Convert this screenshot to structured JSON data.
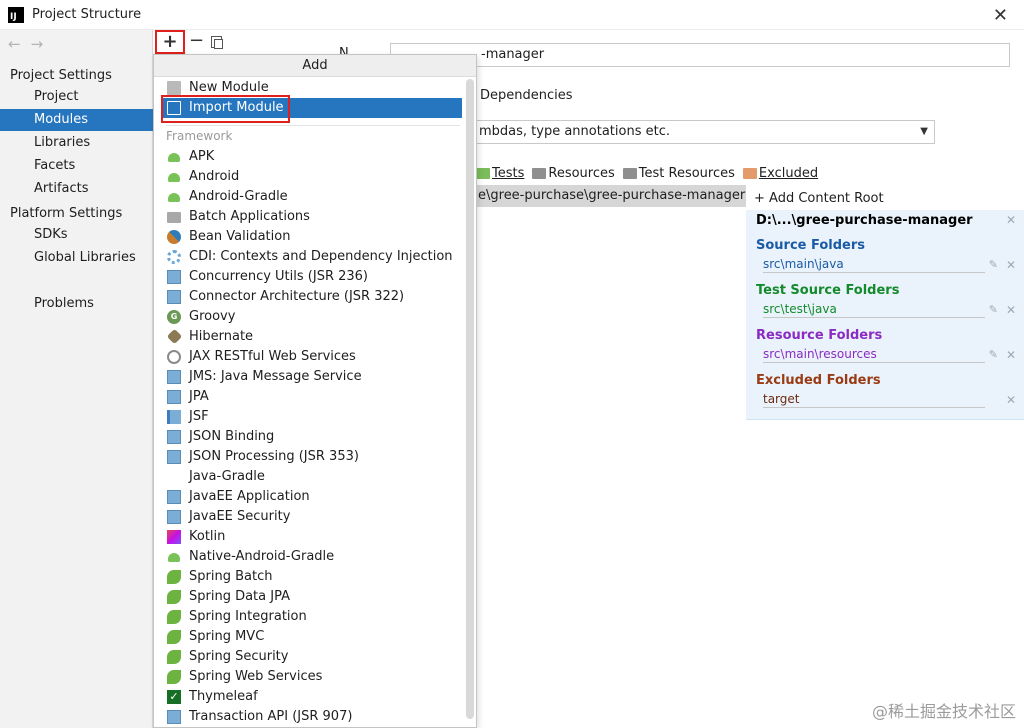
{
  "window": {
    "title": "Project Structure",
    "close": "✕"
  },
  "nav": {
    "back": "←",
    "forward": "→"
  },
  "sidebar": {
    "project_settings": "Project Settings",
    "project_items": [
      "Project",
      "Modules",
      "Libraries",
      "Facets",
      "Artifacts"
    ],
    "platform_settings": "Platform Settings",
    "platform_items": [
      "SDKs",
      "Global Libraries"
    ],
    "problems": "Problems",
    "selected": "Modules"
  },
  "toolbar": {
    "add": "+",
    "remove": "−"
  },
  "module": {
    "name_label": "N",
    "name_value": "-manager",
    "dependencies_tab": "Dependencies",
    "language_level": "mbdas, type annotations etc.",
    "mark_as": [
      "Tests",
      "Resources",
      "Test Resources",
      "Excluded"
    ],
    "content_path": "e\\gree-purchase\\gree-purchase-manager"
  },
  "content_root": {
    "add_label": "+ Add Content Root",
    "path": "D:\\...\\gree-purchase-manager",
    "source_folders": {
      "title": "Source Folders",
      "path": "src\\main\\java",
      "color": "#1a5aa6"
    },
    "test_source_folders": {
      "title": "Test Source Folders",
      "path": "src\\test\\java",
      "color": "#138a2b"
    },
    "resource_folders": {
      "title": "Resource Folders",
      "path": "src\\main\\resources",
      "color": "#8a2bc2"
    },
    "excluded_folders": {
      "title": "Excluded Folders",
      "path": "target",
      "color": "#9a3b14"
    }
  },
  "popup": {
    "title": "Add",
    "top_items": [
      {
        "label": "New Module",
        "icon": "module-icon"
      },
      {
        "label": "Import Module",
        "icon": "import-module-icon",
        "selected": true
      }
    ],
    "section_label": "Framework",
    "framework_items": [
      {
        "label": "APK",
        "icon": "android-icon"
      },
      {
        "label": "Android",
        "icon": "android-icon"
      },
      {
        "label": "Android-Gradle",
        "icon": "android-icon"
      },
      {
        "label": "Batch Applications",
        "icon": "folder-icon"
      },
      {
        "label": "Bean Validation",
        "icon": "bean-icon"
      },
      {
        "label": "CDI: Contexts and Dependency Injection",
        "icon": "cdi-icon"
      },
      {
        "label": "Concurrency Utils (JSR 236)",
        "icon": "jee-icon"
      },
      {
        "label": "Connector Architecture (JSR 322)",
        "icon": "jee-icon"
      },
      {
        "label": "Groovy",
        "icon": "groovy-icon"
      },
      {
        "label": "Hibernate",
        "icon": "hibernate-icon"
      },
      {
        "label": "JAX RESTful Web Services",
        "icon": "globe-icon"
      },
      {
        "label": "JMS: Java Message Service",
        "icon": "jee-icon"
      },
      {
        "label": "JPA",
        "icon": "jpa-icon"
      },
      {
        "label": "JSF",
        "icon": "jsf-icon"
      },
      {
        "label": "JSON Binding",
        "icon": "jee-icon"
      },
      {
        "label": "JSON Processing (JSR 353)",
        "icon": "jee-icon"
      },
      {
        "label": "Java-Gradle",
        "icon": "none"
      },
      {
        "label": "JavaEE Application",
        "icon": "jee-icon"
      },
      {
        "label": "JavaEE Security",
        "icon": "jee-icon"
      },
      {
        "label": "Kotlin",
        "icon": "kotlin-icon"
      },
      {
        "label": "Native-Android-Gradle",
        "icon": "android-icon"
      },
      {
        "label": "Spring Batch",
        "icon": "spring-icon"
      },
      {
        "label": "Spring Data JPA",
        "icon": "spring-icon"
      },
      {
        "label": "Spring Integration",
        "icon": "spring-icon"
      },
      {
        "label": "Spring MVC",
        "icon": "spring-icon"
      },
      {
        "label": "Spring Security",
        "icon": "spring-icon"
      },
      {
        "label": "Spring Web Services",
        "icon": "spring-icon"
      },
      {
        "label": "Thymeleaf",
        "icon": "thymeleaf-icon"
      },
      {
        "label": "Transaction API (JSR 907)",
        "icon": "jee-icon"
      }
    ]
  },
  "colors": {
    "accent": "#2675bf",
    "highlight_box": "#e0201c"
  },
  "watermark": "@稀土掘金技术社区"
}
